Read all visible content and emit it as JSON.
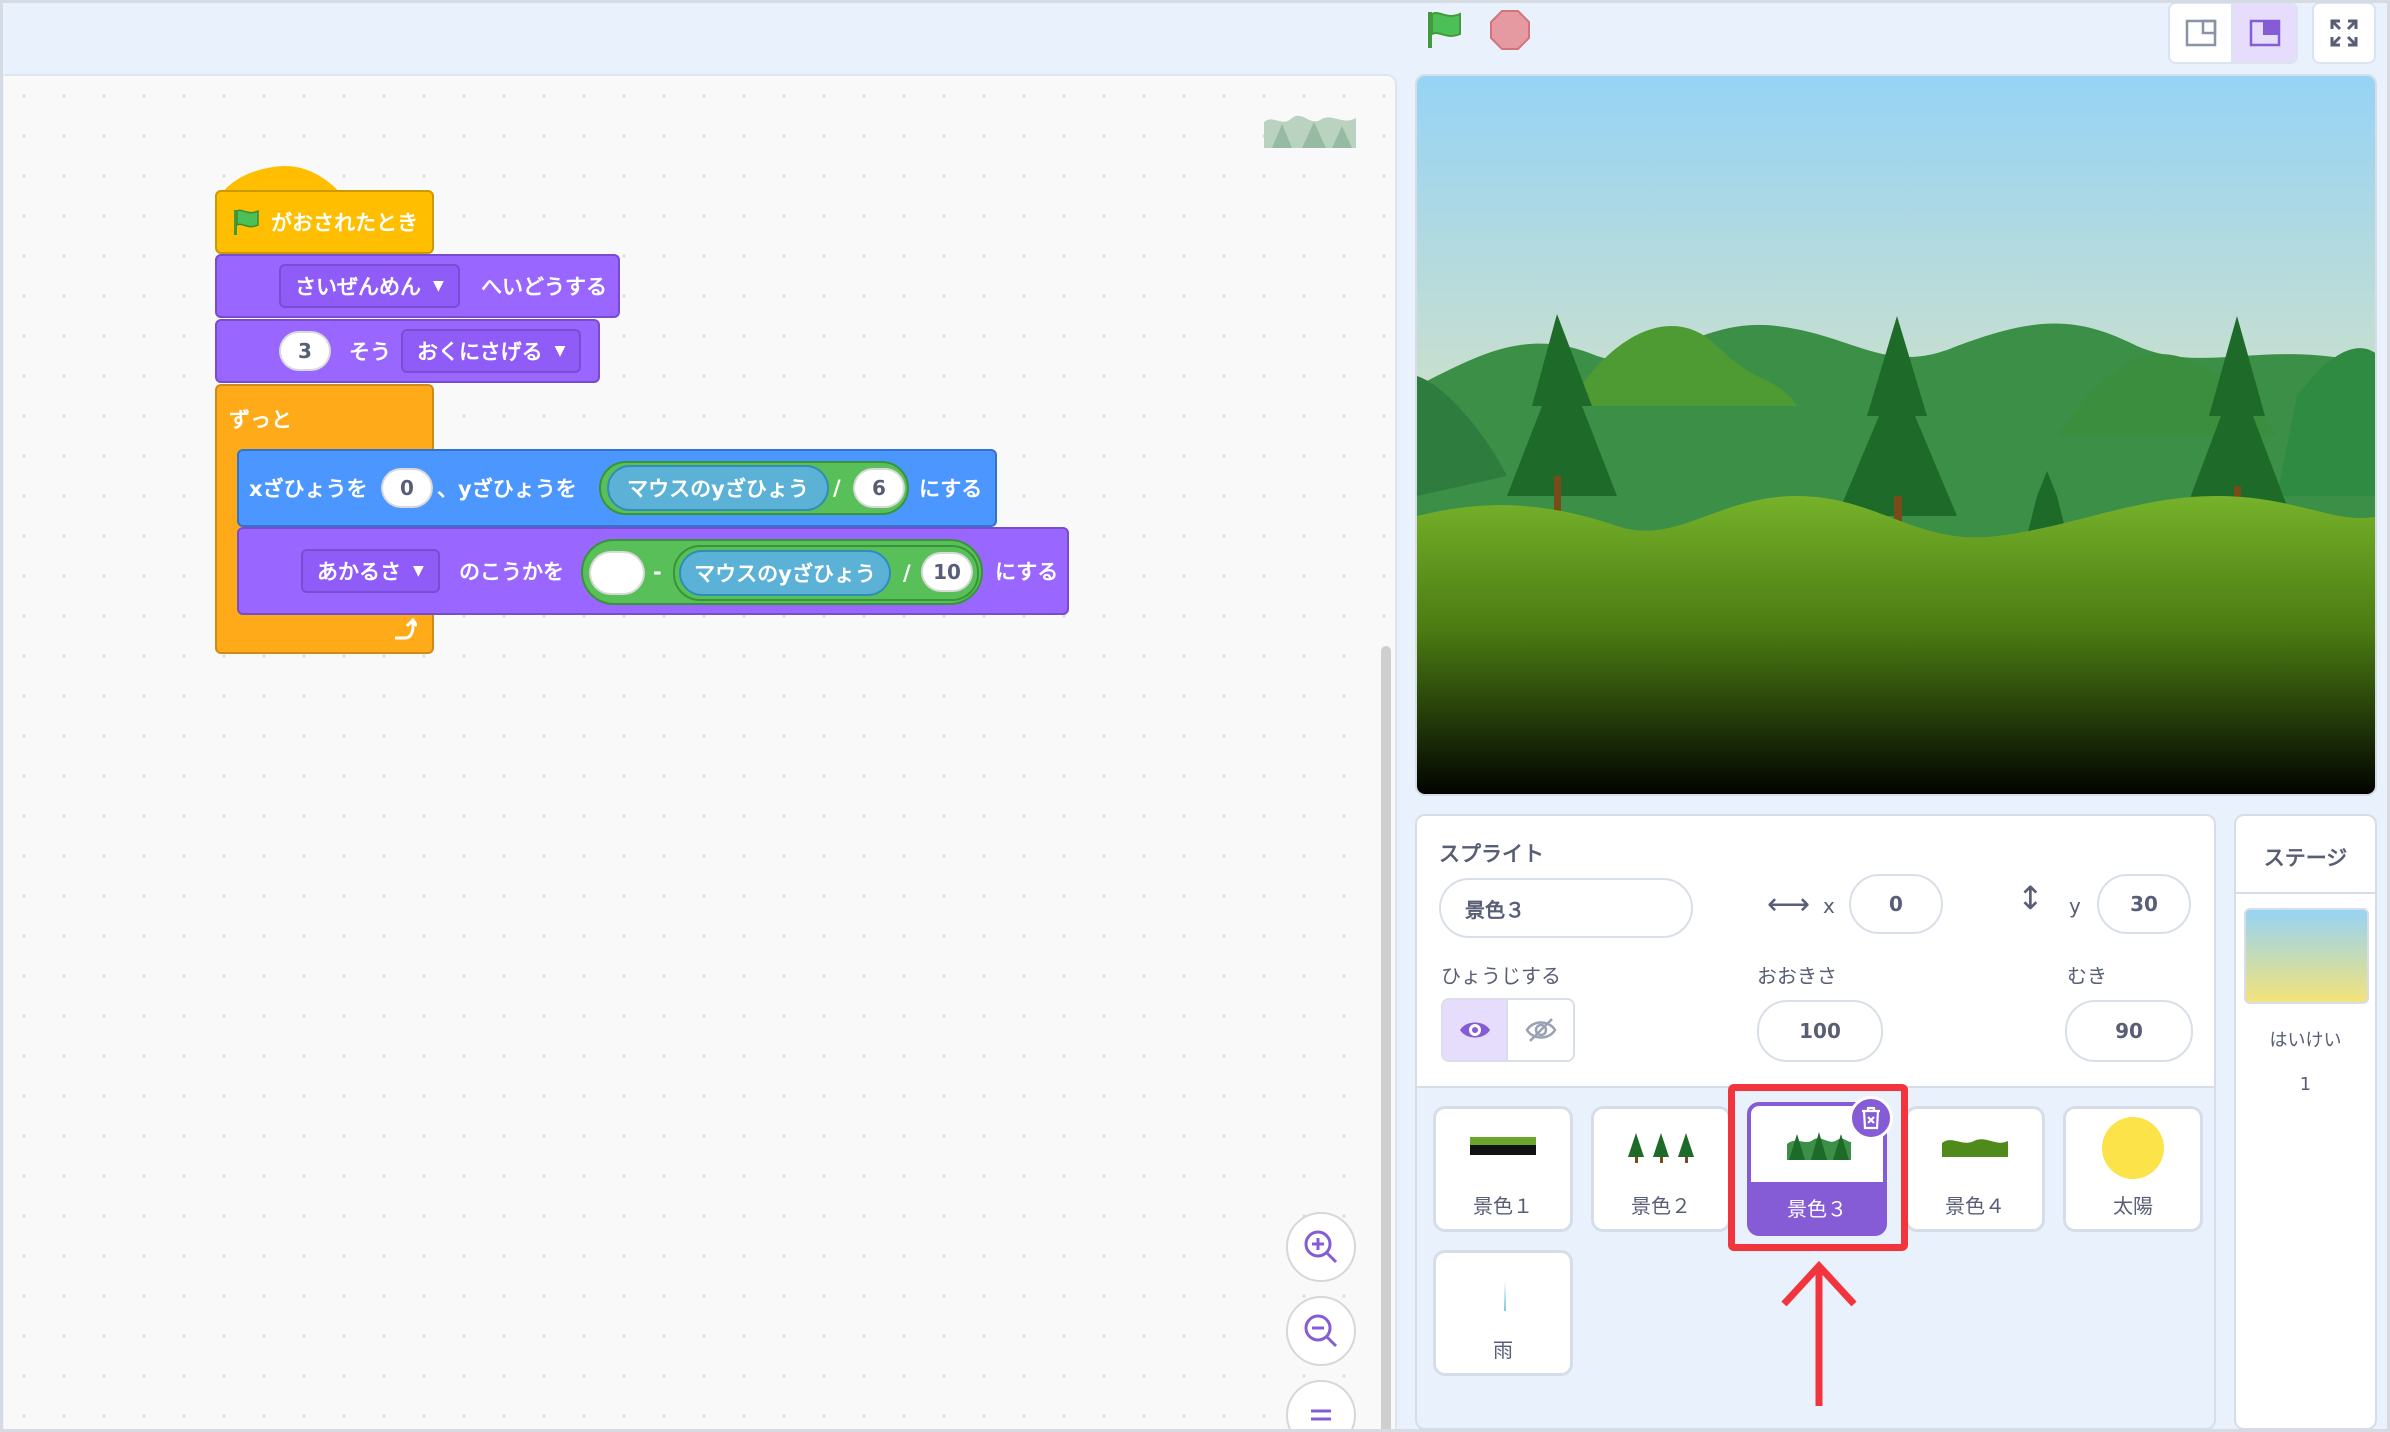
{
  "toolbar": {
    "go_icon": "green-flag-icon",
    "stop_icon": "stop-icon",
    "layout_small": "small-stage-icon",
    "layout_normal": "normal-stage-icon",
    "fullscreen": "fullscreen-icon"
  },
  "code": {
    "hat": "がおされたとき",
    "goto_layer_menu": "さいぜんめん",
    "goto_layer_suffix": "へいどうする",
    "layers_num": "3",
    "layers_mid": "そう",
    "layers_menu": "おくにさげる",
    "forever": "ずっと",
    "setxy_x_label": "xざひょうを",
    "setxy_x_value": "0",
    "setxy_y_label": "、yざひょうを",
    "mouse_y_1": "マウスのyざひょう",
    "divide_1": "/",
    "divide_1_value": "6",
    "setxy_suffix": "にする",
    "effect_menu": "あかるさ",
    "effect_mid": "のこうかを",
    "minus_left": "",
    "minus": "-",
    "mouse_y_2": "マウスのyざひょう",
    "divide_2": "/",
    "divide_2_value": "10",
    "effect_suffix": "にする"
  },
  "sprite_info": {
    "title": "スプライト",
    "name": "景色３",
    "x_label": "x",
    "x": "0",
    "y_label": "y",
    "y": "30",
    "show_label": "ひょうじする",
    "size_label": "おおきさ",
    "size": "100",
    "direction_label": "むき",
    "direction": "90"
  },
  "sprites": [
    {
      "name": "景色１"
    },
    {
      "name": "景色２"
    },
    {
      "name": "景色３"
    },
    {
      "name": "景色４"
    },
    {
      "name": "太陽"
    },
    {
      "name": "雨"
    }
  ],
  "stage_panel": {
    "title": "ステージ",
    "backdrop_label": "はいけい",
    "backdrop_count": "1"
  },
  "colors": {
    "motion": "#4c97ff",
    "looks": "#9966ff",
    "events": "#ffbf00",
    "control": "#ffab19",
    "sensing": "#5cb1d6",
    "operators": "#59c059",
    "selected": "#855cd6",
    "annotation": "#f2343c"
  }
}
